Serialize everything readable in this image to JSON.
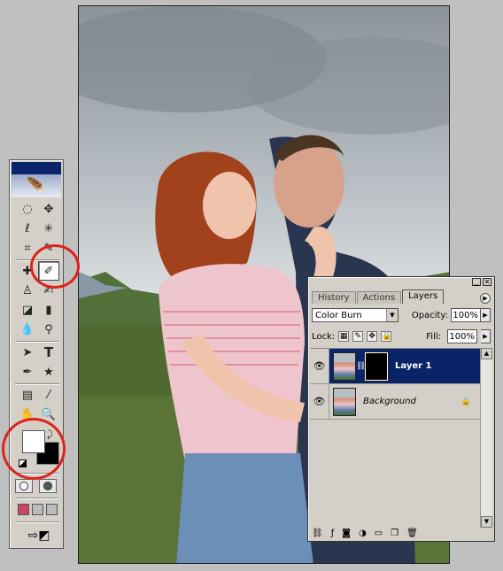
{
  "palette": {
    "tabs": [
      {
        "label": "History"
      },
      {
        "label": "Actions"
      },
      {
        "label": "Layers"
      }
    ],
    "blend_mode": "Color Burn",
    "opacity_label": "Opacity:",
    "opacity_value": "100%",
    "lock_label": "Lock:",
    "fill_label": "Fill:",
    "fill_value": "100%",
    "layers": [
      {
        "name": "Layer 1",
        "selected": true
      },
      {
        "name": "Background",
        "selected": false
      }
    ]
  },
  "toolbox": {
    "foreground_color": "#ffffff",
    "background_color": "#000000",
    "active_tool": "brush-tool"
  },
  "colors": {
    "highlight_ring": "#e0201a",
    "selection": "#0a246a"
  },
  "icons": {
    "toolbox": [
      "marquee-tool",
      "move-tool",
      "lasso-tool",
      "magic-wand-tool",
      "crop-tool",
      "slice-tool",
      "healing-tool",
      "brush-tool",
      "stamp-tool",
      "history-brush-tool",
      "eraser-tool",
      "gradient-tool",
      "blur-tool",
      "dodge-tool",
      "path-select-tool",
      "type-tool",
      "pen-tool",
      "shape-tool",
      "notes-tool",
      "eyedropper-tool",
      "hand-tool",
      "zoom-tool"
    ],
    "palette_bottom": [
      "link-icon",
      "layer-style-icon",
      "mask-icon",
      "adjustment-icon",
      "folder-icon",
      "new-layer-icon",
      "trash-icon"
    ]
  }
}
